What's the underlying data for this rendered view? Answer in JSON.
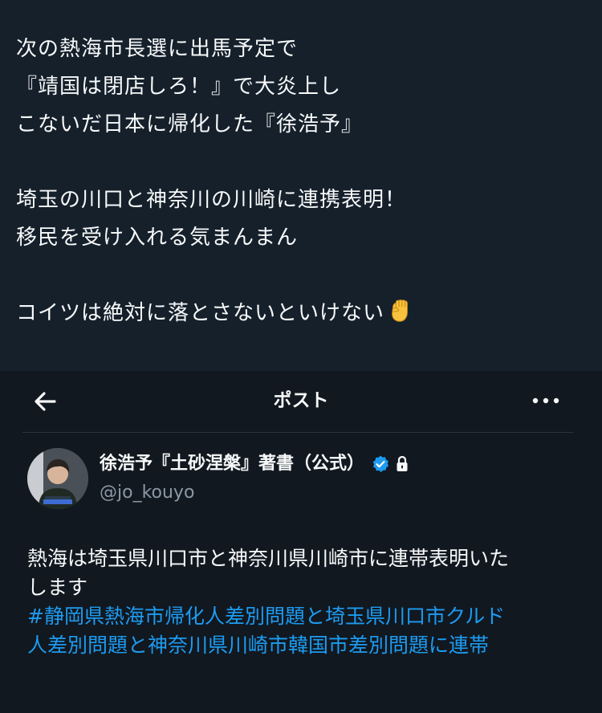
{
  "post": {
    "lines": [
      "次の熱海市長選に出馬予定で",
      "『靖国は閉店しろ！』で大炎上し",
      "こないだ日本に帰化した『徐浩予』",
      "埼玉の川口と神奈川の川崎に連携表明！",
      "移民を受け入れる気まんまん",
      "コイツは絶対に落とさないといけない"
    ],
    "emoji": "fist-emoji"
  },
  "embed": {
    "header_title": "ポスト",
    "back_icon": "back-arrow-icon",
    "more_icon": "more-dots-icon",
    "author": {
      "name": "徐浩予『土砂涅槃』著書（公式）",
      "handle": "@jo_kouyo",
      "verified": true,
      "protected": true
    },
    "body_lines": [
      "熱海は埼玉県川口市と神奈川県川崎市に連帯表明いた",
      "します"
    ],
    "hashtag_lines": [
      "#静岡県熱海市帰化人差別問題と埼玉県川口市クルド",
      "人差別問題と神奈川県川崎市韓国市差別問題に連帯"
    ]
  },
  "colors": {
    "background": "#15202b",
    "text": "#f7f9f9",
    "secondary_text": "#8b98a5",
    "link": "#1d9bf0",
    "verified_badge": "#1d9bf0"
  }
}
